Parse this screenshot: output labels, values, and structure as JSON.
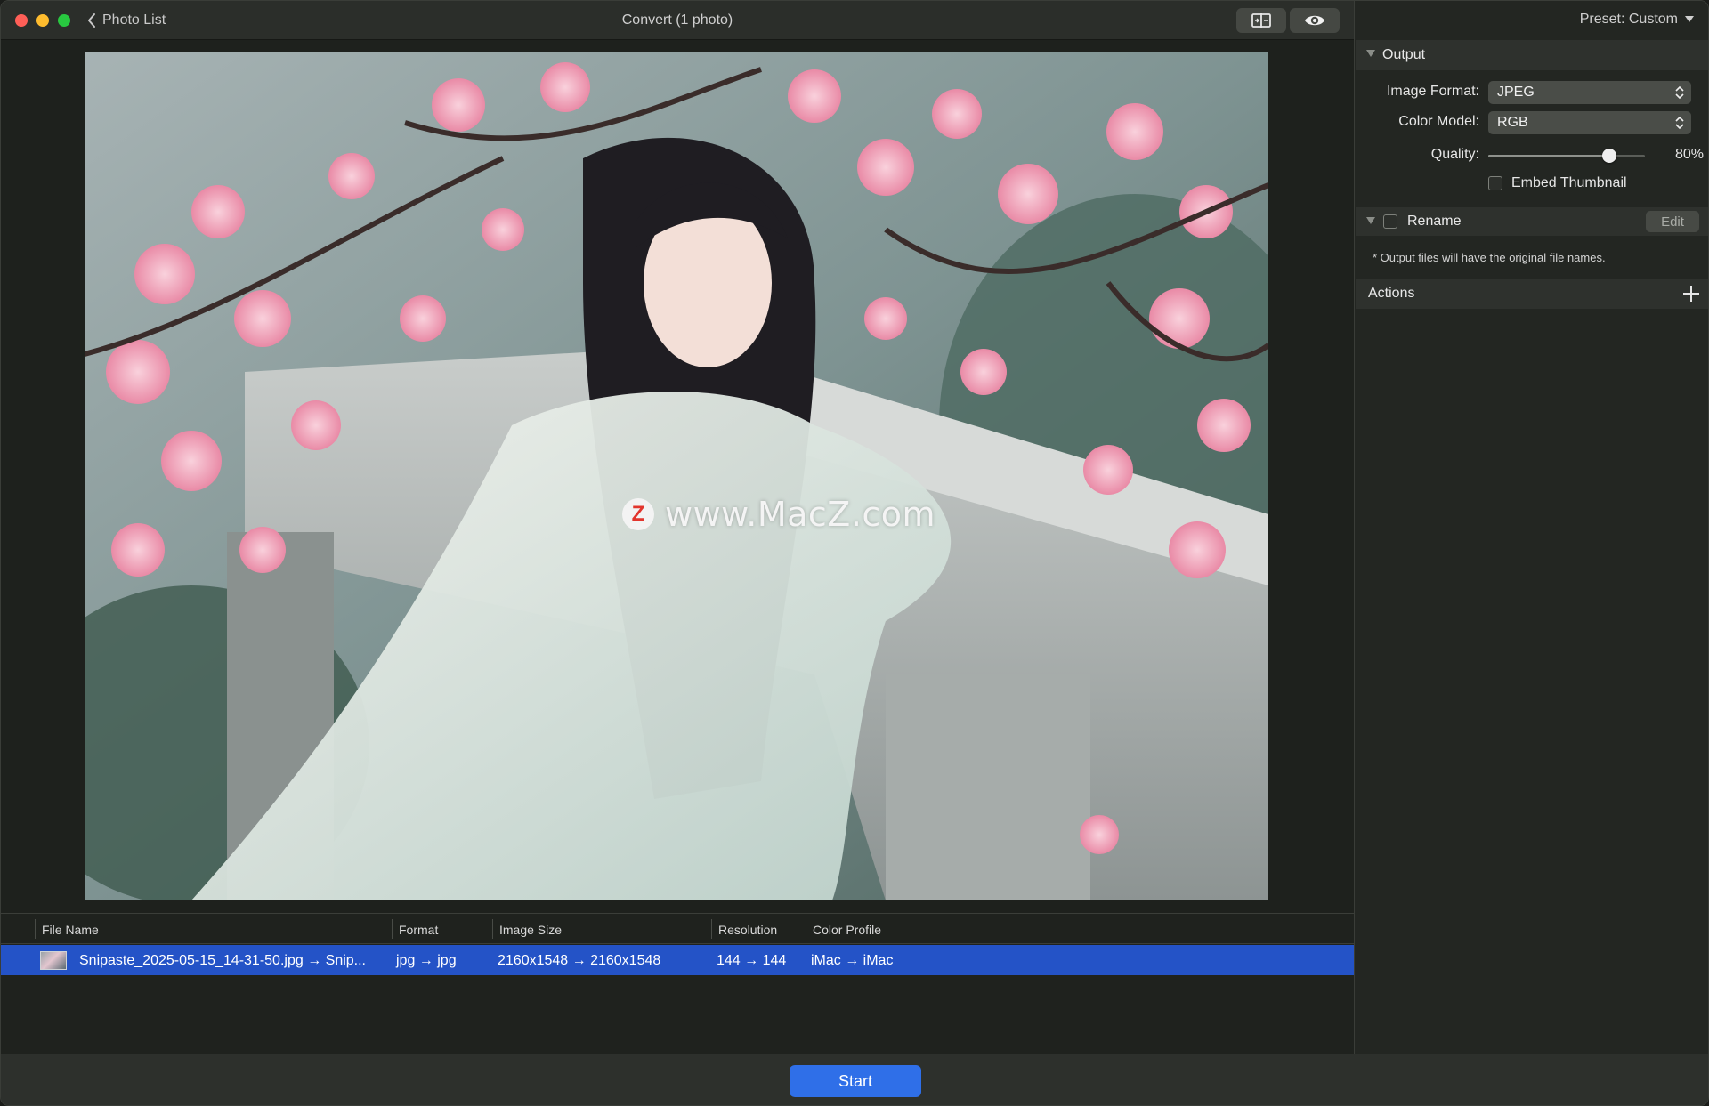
{
  "window": {
    "title": "Convert (1 photo)",
    "back_label": "Photo List",
    "preset_label": "Preset: Custom"
  },
  "preview": {
    "watermark_text": "www.MacZ.com",
    "watermark_logo_letter": "Z"
  },
  "table": {
    "headers": [
      "File Name",
      "Format",
      "Image Size",
      "Resolution",
      "Color Profile"
    ],
    "rows": [
      {
        "file_name": "Snipaste_2025-05-15_14-31-50.jpg → Snip...",
        "format": "jpg → jpg",
        "image_size": "2160x1548 → 2160x1548",
        "resolution": "144 → 144",
        "color_profile": "iMac → iMac"
      }
    ]
  },
  "sidebar": {
    "output": {
      "title": "Output",
      "image_format_label": "Image Format:",
      "image_format_value": "JPEG",
      "color_model_label": "Color Model:",
      "color_model_value": "RGB",
      "quality_label": "Quality:",
      "quality_value": "80%",
      "quality_fraction": 0.8,
      "embed_thumbnail_label": "Embed Thumbnail",
      "embed_thumbnail_checked": false
    },
    "rename": {
      "title": "Rename",
      "checked": false,
      "edit_label": "Edit",
      "note": "* Output files will have the original file names."
    },
    "actions": {
      "title": "Actions"
    }
  },
  "bottom": {
    "start_label": "Start"
  },
  "colors": {
    "accent": "#2f6fe8",
    "selection": "#2453c7",
    "close": "#ff5f57",
    "minimize": "#febc2e",
    "maximize": "#28c840"
  }
}
